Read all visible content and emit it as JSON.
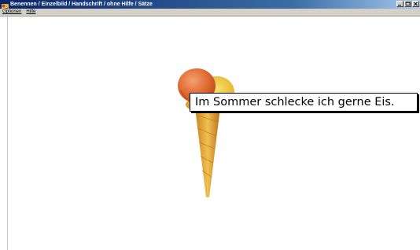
{
  "window": {
    "title": "Benennen / Einzelbild / Handschrift / ohne Hilfe / Sätze",
    "icon": "app-icon",
    "controls": [
      "minimize-icon",
      "maximize-icon",
      "close-icon"
    ]
  },
  "menu": {
    "items": [
      {
        "label": "Optionen"
      },
      {
        "label": "Hilfe"
      }
    ]
  },
  "main": {
    "image": "ice-cream-cone-image",
    "caption": "Im Sommer schlecke ich gerne Eis."
  }
}
